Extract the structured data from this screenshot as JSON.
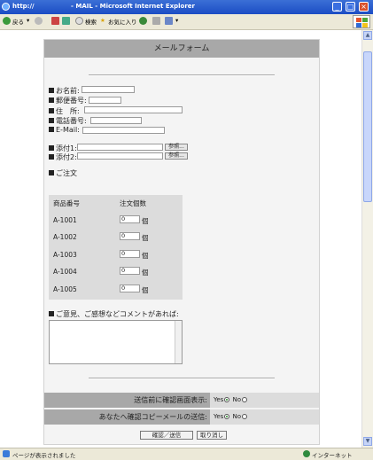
{
  "window": {
    "title": "http://                 - MAIL - Microsoft Internet Explorer"
  },
  "toolbar": {
    "back": "戻る",
    "search": "検索",
    "favorites": "お気に入り"
  },
  "form": {
    "title": "メールフォーム",
    "fields": {
      "name": "お名前:",
      "zip": "郵便番号:",
      "address": "住　所:",
      "phone": "電話番号:",
      "email": "E-Mail:"
    },
    "attachments": {
      "a1": "添付1:",
      "a2": "添付2:",
      "browse": "参照..."
    },
    "order": {
      "label": "ご注文",
      "headers": [
        "商品番号",
        "注文個数"
      ],
      "unit": "個",
      "rows": [
        {
          "code": "A-1001",
          "qty": "0"
        },
        {
          "code": "A-1002",
          "qty": "0"
        },
        {
          "code": "A-1003",
          "qty": "0"
        },
        {
          "code": "A-1004",
          "qty": "0"
        },
        {
          "code": "A-1005",
          "qty": "0"
        }
      ]
    },
    "comment_label": "ご意見、ご感想などコメントがあれば:",
    "confirm": {
      "label": "送信前に確認画面表示:",
      "yes": "Yes",
      "no": "No",
      "selected": "Yes"
    },
    "copy": {
      "label": "あなたへ確認コピーメールの送信:",
      "yes": "Yes",
      "no": "No",
      "selected": "Yes"
    },
    "submit": "確認／送信",
    "reset": "取り消し"
  },
  "status": {
    "left": "ページが表示されました",
    "zone": "インターネット"
  }
}
